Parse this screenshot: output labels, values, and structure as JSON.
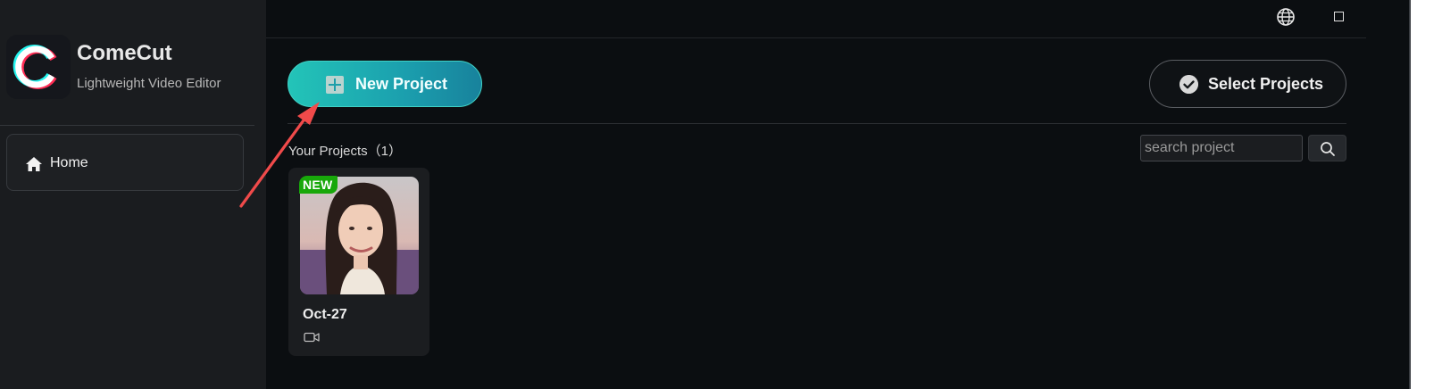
{
  "sidebar": {
    "app_name": "ComeCut",
    "app_subtitle": "Lightweight Video Editor",
    "nav": [
      {
        "label": "Home",
        "icon": "home-icon"
      }
    ]
  },
  "header": {
    "icons": [
      "globe-icon",
      "maximize-icon"
    ]
  },
  "toolbar": {
    "new_project_label": "New Project",
    "select_projects_label": "Select Projects"
  },
  "projects": {
    "heading": "Your Projects（1）",
    "search_placeholder": "search project",
    "items": [
      {
        "name": "Oct-27",
        "badge": "NEW",
        "type_icon": "video-camera-icon"
      }
    ]
  },
  "colors": {
    "accent_start": "#23c4b8",
    "accent_end": "#18829c",
    "annotation_arrow": "#f04a4a",
    "badge": "#18a80a"
  }
}
